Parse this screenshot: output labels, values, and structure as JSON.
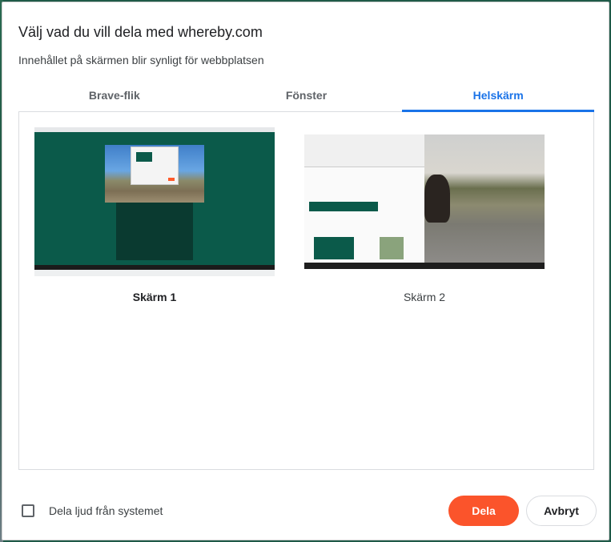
{
  "dialog": {
    "title": "Välj vad du vill dela med whereby.com",
    "subtitle": "Innehållet på skärmen blir synligt för webbplatsen"
  },
  "tabs": [
    {
      "label": "Brave-flik",
      "active": false
    },
    {
      "label": "Fönster",
      "active": false
    },
    {
      "label": "Helskärm",
      "active": true
    }
  ],
  "screens": [
    {
      "label": "Skärm 1",
      "selected": true
    },
    {
      "label": "Skärm 2",
      "selected": false
    }
  ],
  "footer": {
    "audio_label": "Dela ljud från systemet",
    "audio_checked": false,
    "share_label": "Dela",
    "cancel_label": "Avbryt"
  },
  "colors": {
    "accent": "#1a73e8",
    "share_button": "#fb542b"
  }
}
